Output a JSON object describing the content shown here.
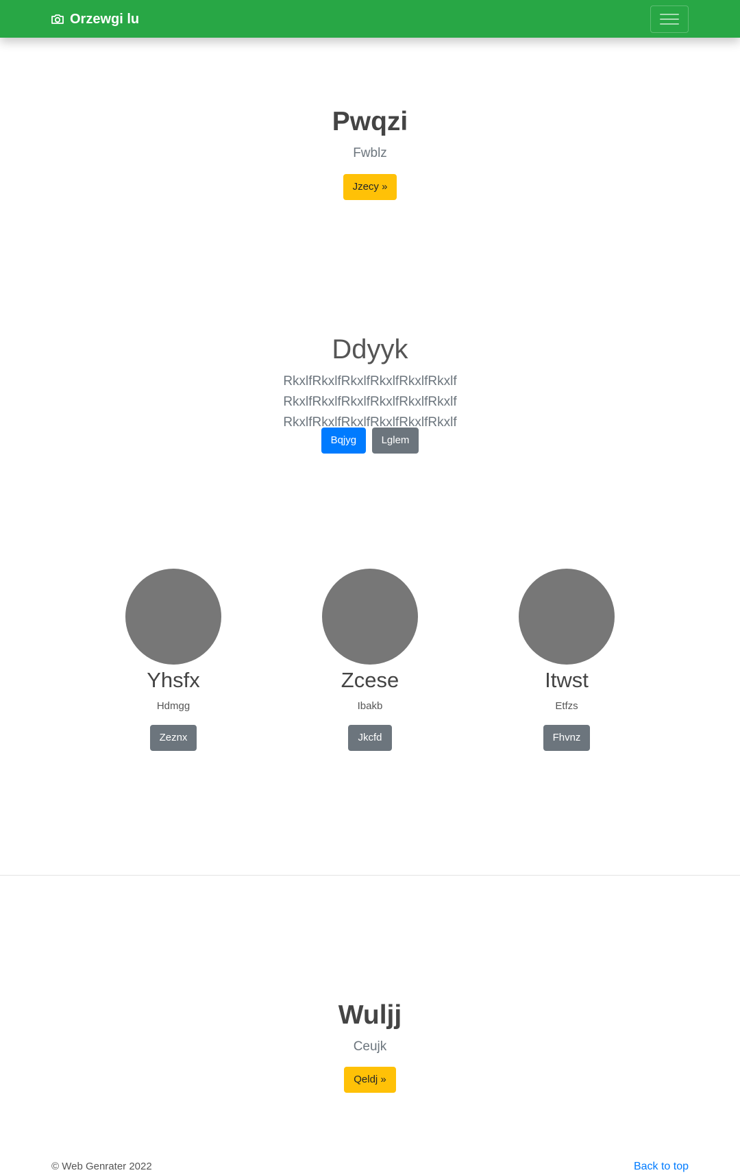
{
  "navbar": {
    "brand_icon": "camera-icon",
    "brand": "Orzewgi lu",
    "toggler_icon": "hamburger-icon"
  },
  "hero_top": {
    "title": "Pwqzi",
    "subtitle": "Fwblz",
    "button": "Jzecy »"
  },
  "section2": {
    "title": "Ddyyk",
    "lead": "RkxlfRkxlfRkxlfRkxlfRkxlfRkxlf RkxlfRkxlfRkxlfRkxlfRkxlfRkxlf RkxlfRkxlfRkxlfRkxlfRkxlfRkxlf",
    "primary_button": "Bqjyg",
    "secondary_button": "Lglem"
  },
  "cards": [
    {
      "name": "Yhsfx",
      "desc": "Hdmgg",
      "button": "Zeznx"
    },
    {
      "name": "Zcese",
      "desc": "Ibakb",
      "button": "Jkcfd"
    },
    {
      "name": "Itwst",
      "desc": "Etfzs",
      "button": "Fhvnz"
    }
  ],
  "hero_bottom": {
    "title": "Wuljj",
    "subtitle": "Ceujk",
    "button": "Qeldj »"
  },
  "footer": {
    "copyright": "© Web Genrater 2022",
    "back_to_top": "Back to top"
  },
  "colors": {
    "navbar": "#28a745",
    "warning": "#ffc107",
    "primary": "#007bff",
    "secondary": "#6c757d",
    "placeholder_circle": "#777777"
  }
}
